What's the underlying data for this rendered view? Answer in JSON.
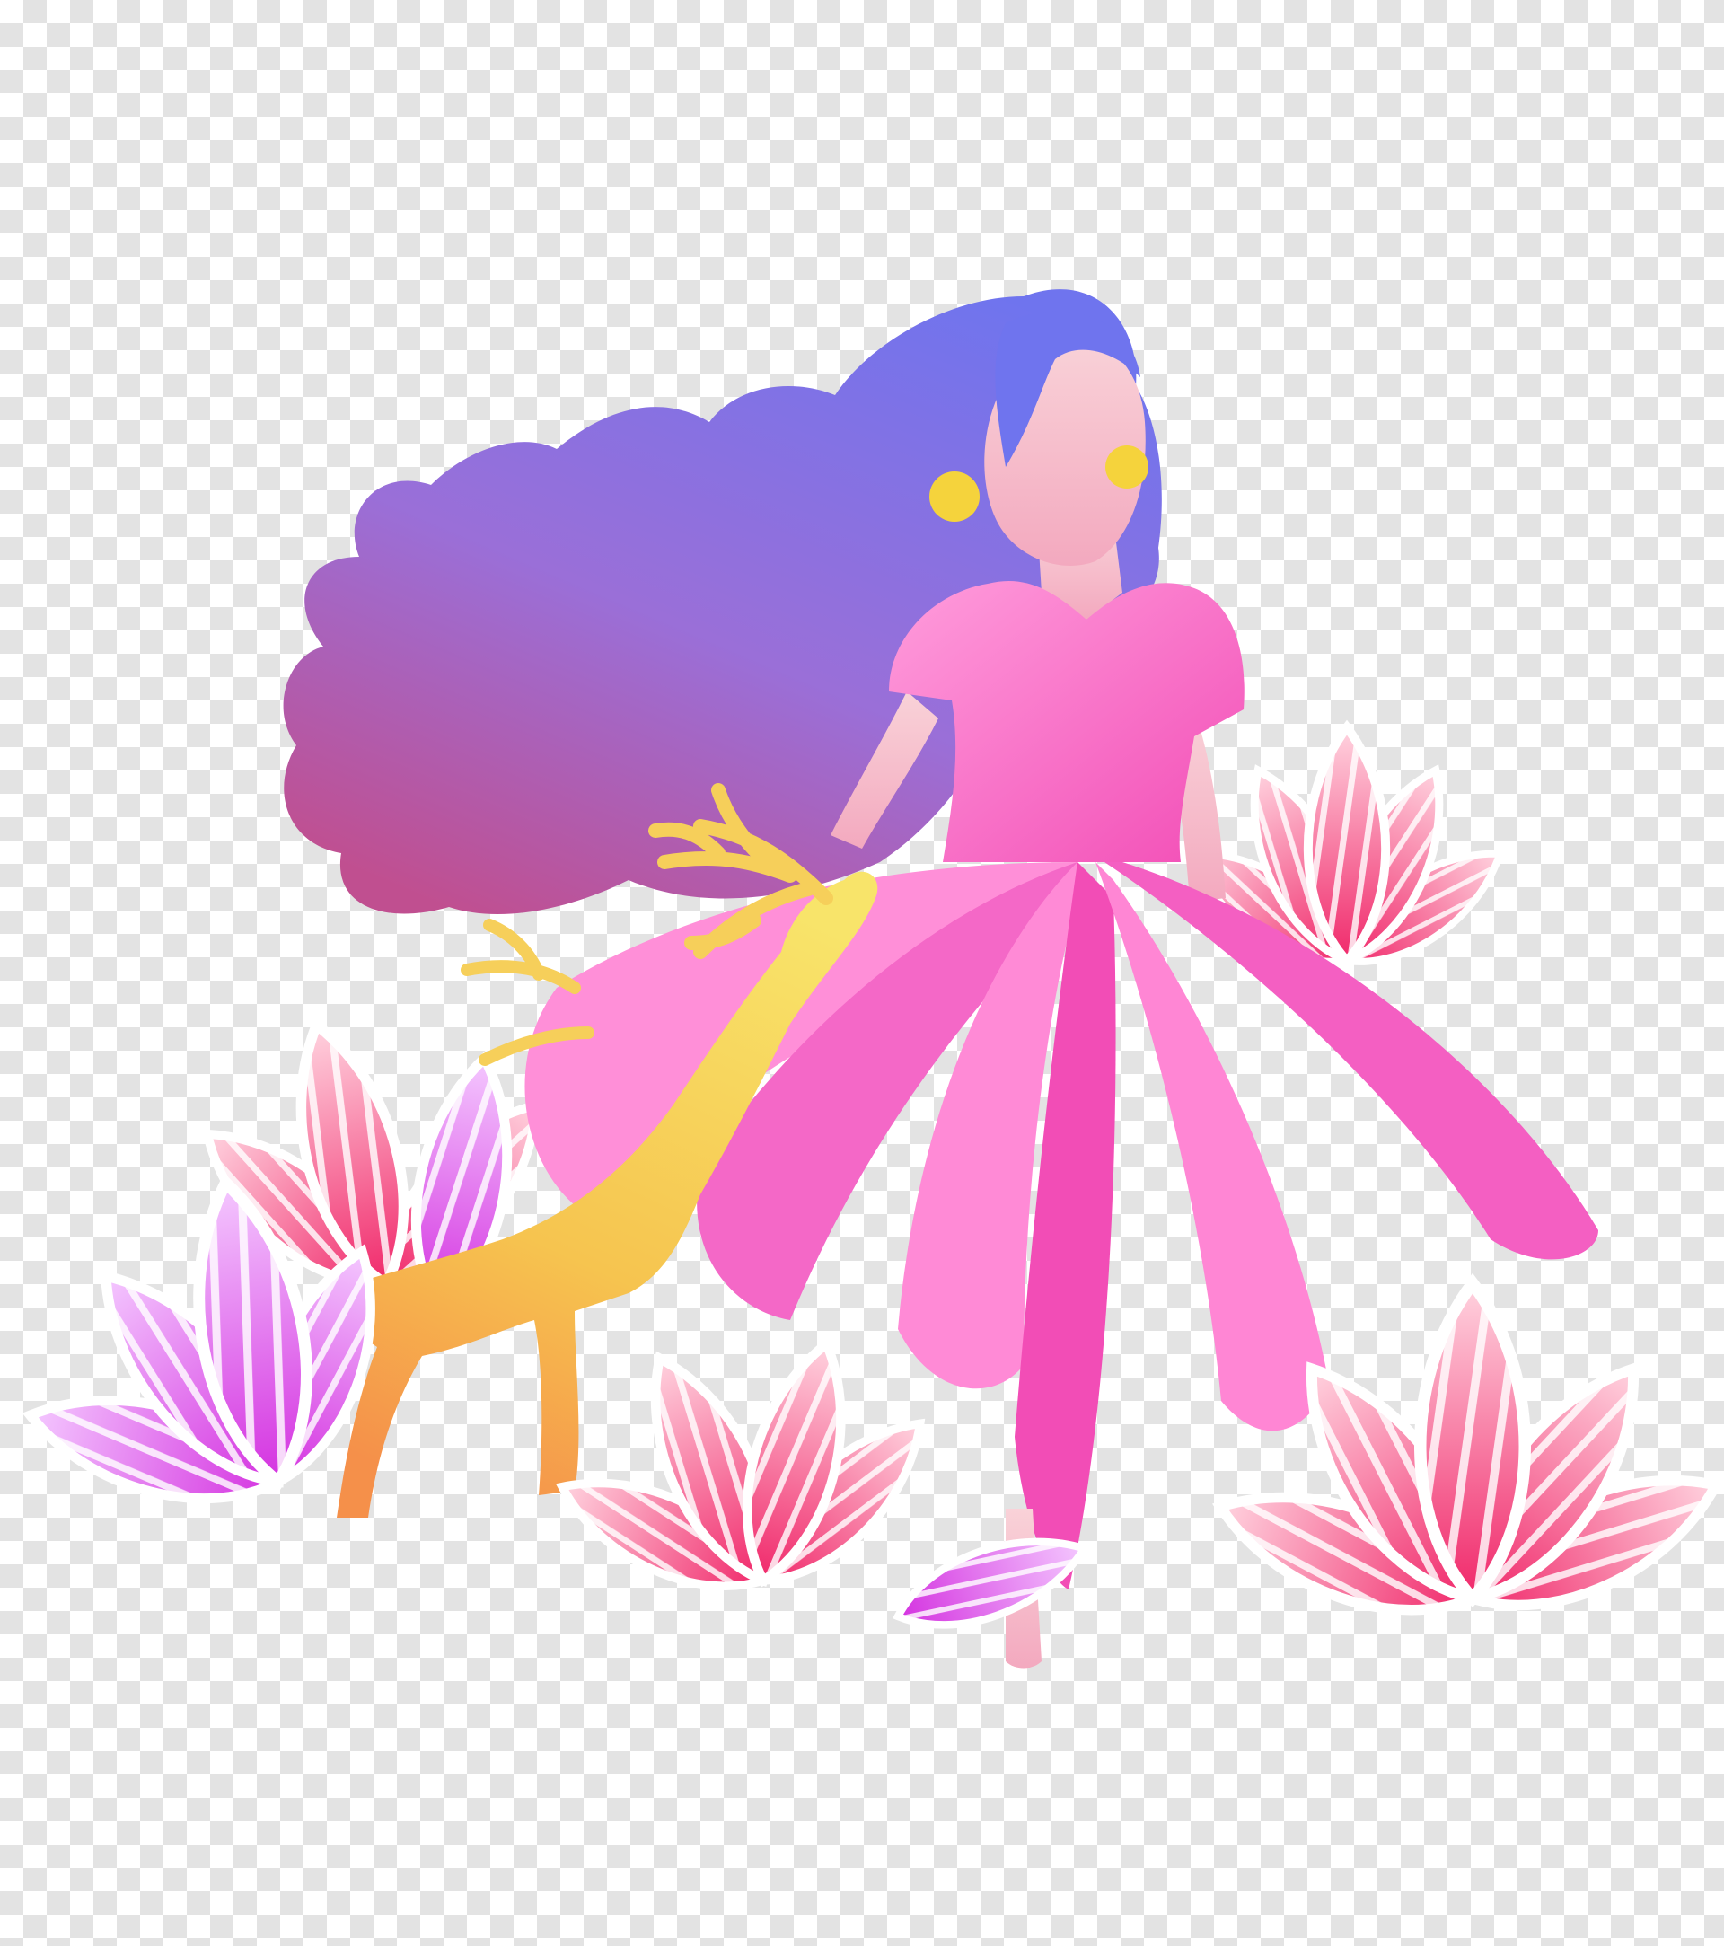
{
  "canvas": {
    "background": "transparency-checkerboard",
    "checker_colors": [
      "#ffffff",
      "#e3e3e3"
    ]
  },
  "illustration": {
    "subject": "girl-in-petal-dress-with-deer-and-lotus-flowers",
    "colors": {
      "hair_top": "#6f74ee",
      "hair_bottom": "#c04f90",
      "skin": "#f7c3cc",
      "earring": "#f5d33c",
      "dress_light": "#ff8fd8",
      "dress_dark": "#f250b9",
      "deer_top": "#f8e46a",
      "deer_bottom": "#f59a4a",
      "lotus_pink_light": "#ffd3df",
      "lotus_pink_dark": "#f0286a",
      "lotus_purple_light": "#f4c8ff",
      "lotus_purple_dark": "#d432e0"
    }
  }
}
